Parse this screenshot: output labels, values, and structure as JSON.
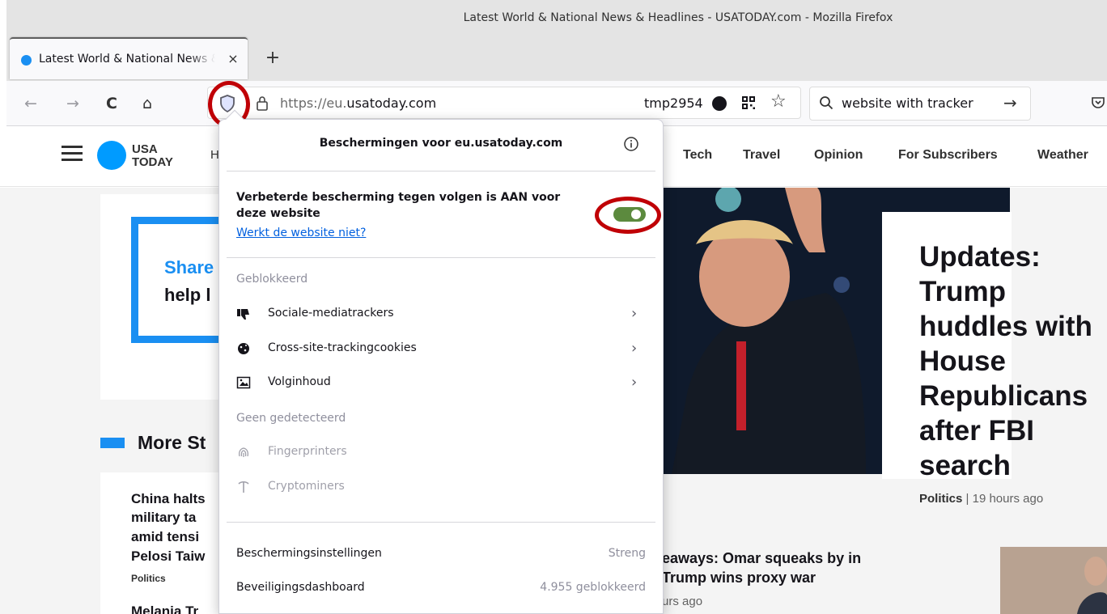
{
  "window": {
    "title": "Latest World & National News & Headlines - USATODAY.com - Mozilla Firefox"
  },
  "tab": {
    "label": "Latest World & National News & Headlines",
    "close": "×",
    "new_tab": "+"
  },
  "toolbar": {
    "back": "←",
    "forward": "→",
    "reload": "C",
    "home": "⌂",
    "url_prefix": "https://eu.",
    "url_domain": "usatoday.com",
    "container_name": "tmp2954",
    "bookmark_star": "☆",
    "search_value": "website with tracker",
    "search_go": "→"
  },
  "site": {
    "logo_line1": "USA",
    "logo_line2": "TODAY",
    "nav_partial": "H",
    "nav": [
      "Tech",
      "Travel",
      "Opinion",
      "For Subscribers",
      "Weather"
    ],
    "promo_line1": "Share",
    "promo_line2": "help l",
    "more_stories": "More St",
    "story_lines": [
      "China halts",
      "military ta",
      "amid tensi",
      "Pelosi Taiw"
    ],
    "story_tag": "Politics",
    "story_next": "Melania Tr",
    "headline": "Updates: Trump huddles with House Republicans after FBI search",
    "headline_section": "Politics",
    "headline_sep": "|",
    "headline_time": "19 hours ago",
    "sub_line1": "eaways: Omar squeaks by in",
    "sub_line2": "Trump wins proxy war",
    "sub_time": "urs ago"
  },
  "protections": {
    "title": "Beschermingen voor eu.usatoday.com",
    "etp_status": "Verbeterde bescherming tegen volgen is AAN voor deze website",
    "site_broken_link": "Werkt de website niet?",
    "toggle_on": true,
    "blocked_label": "Geblokkeerd",
    "blocked": [
      {
        "label": "Sociale-mediatrackers",
        "icon": "thumbs-down-icon"
      },
      {
        "label": "Cross-site-trackingcookies",
        "icon": "cookie-icon"
      },
      {
        "label": "Volginhoud",
        "icon": "image-icon"
      }
    ],
    "not_detected_label": "Geen gedetecteerd",
    "not_detected": [
      {
        "label": "Fingerprinters",
        "icon": "fingerprint-icon"
      },
      {
        "label": "Cryptominers",
        "icon": "pickaxe-icon"
      }
    ],
    "settings_label": "Beschermingsinstellingen",
    "settings_value": "Streng",
    "dashboard_label": "Beveiligingsdashboard",
    "dashboard_value": "4.955 geblokkeerd"
  },
  "colors": {
    "annotation": "#c00006",
    "toggle_on": "#5c8a3e",
    "brand": "#009bff",
    "link": "#0060df"
  }
}
